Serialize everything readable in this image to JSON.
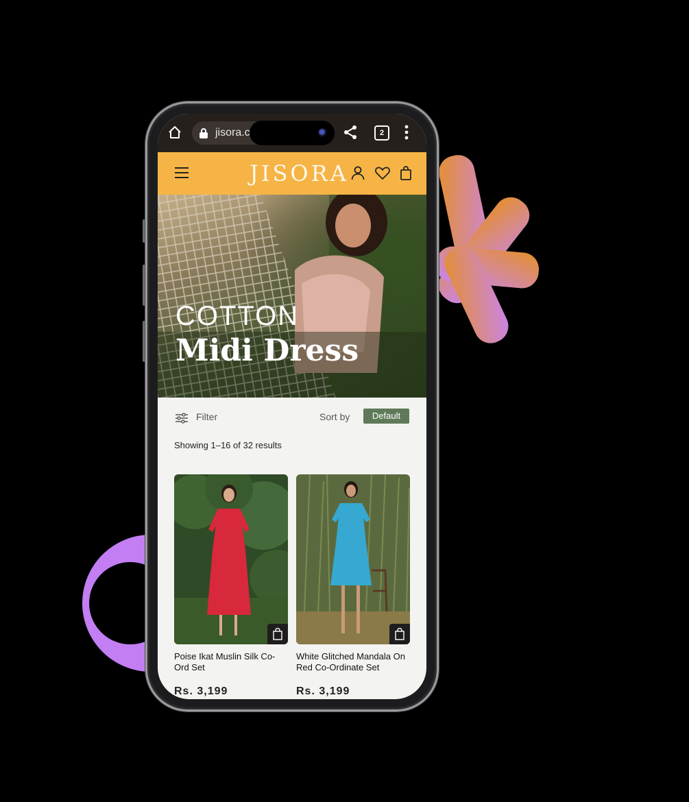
{
  "browser": {
    "url": "jisora.c",
    "tab_count": "2",
    "icons": [
      "home-icon",
      "lock-icon",
      "share-icon",
      "tabs-icon",
      "more-vertical-icon"
    ]
  },
  "site": {
    "logo": "JISORA",
    "header_color": "#f5b445",
    "icons": [
      "menu-icon",
      "account-icon",
      "wishlist-heart-icon",
      "shopping-bag-icon"
    ]
  },
  "hero": {
    "line1": "COTTON",
    "line2": "Midi Dress"
  },
  "toolbar": {
    "filter_label": "Filter",
    "sort_label": "Sort by",
    "sort_value": "Default",
    "sort_color": "#5f7a59"
  },
  "results_text": "Showing 1–16 of 32 results",
  "products": [
    {
      "name": "Poise Ikat Muslin Silk Co-Ord Set",
      "price": "Rs. 3,199"
    },
    {
      "name": "White Glitched Mandala On Red Co-Ordinate Set",
      "price": "Rs. 3,199"
    }
  ],
  "colors": {
    "accent_orange": "#e99a3c",
    "accent_purple": "#c783f0"
  }
}
